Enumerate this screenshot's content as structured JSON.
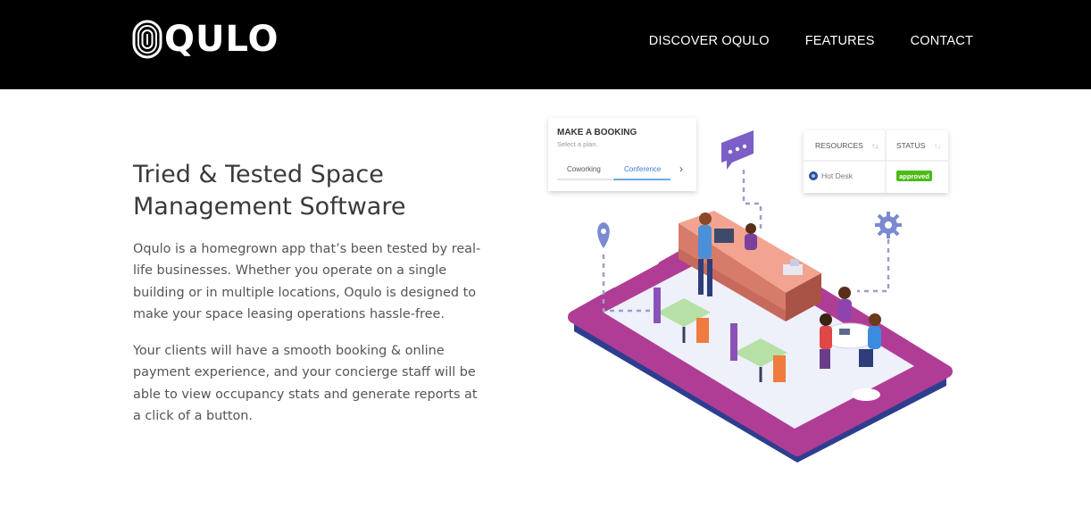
{
  "header": {
    "logo_text": "QULO",
    "nav": [
      "DISCOVER OQULO",
      "FEATURES",
      "CONTACT"
    ]
  },
  "hero": {
    "title": "Tried & Tested Space Management Software",
    "paragraphs": [
      "Oqulo is a homegrown app that’s been tested by real-life businesses. Whether you operate on a single building or in multiple locations, Oqulo is designed to make your space leasing operations hassle-free.",
      "Your clients will have a smooth booking & online payment experience, and your concierge staff will be able to view occupancy stats and generate reports at a click of a button."
    ]
  },
  "illustration": {
    "booking_card": {
      "title": "MAKE A BOOKING",
      "subtitle": "Select a plan.",
      "tabs": [
        "Coworking",
        "Conference"
      ],
      "arrow": "›"
    },
    "resources_table": {
      "headers": [
        "RESOURCES",
        "STATUS"
      ],
      "sort_glyph": "↑↓",
      "row": {
        "resource": "Hot Desk",
        "status": "approved"
      }
    },
    "icons": [
      "chat-bubble-icon",
      "location-pin-icon",
      "gear-icon"
    ]
  },
  "colors": {
    "header_bg": "#000000",
    "phone_magenta": "#b03d95",
    "phone_edge": "#2e3e8f",
    "status_green": "#4cbb17",
    "tab_underline": "#3a8dde",
    "dash_lines": "#9aa0c6"
  }
}
